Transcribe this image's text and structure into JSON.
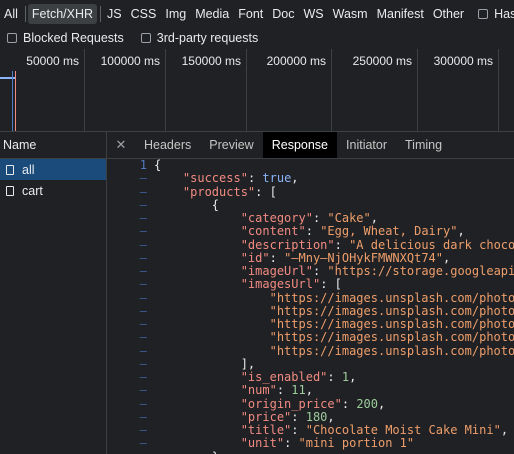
{
  "filters": {
    "types": [
      "All",
      "Fetch/XHR",
      "JS",
      "CSS",
      "Img",
      "Media",
      "Font",
      "Doc",
      "WS",
      "Wasm",
      "Manifest",
      "Other"
    ],
    "active": "Fetch/XHR",
    "has_label": "Has",
    "blocked_requests_label": "Blocked Requests",
    "third_party_label": "3rd-party requests"
  },
  "timeline": {
    "ticks": [
      "50000 ms",
      "100000 ms",
      "150000 ms",
      "200000 ms",
      "250000 ms",
      "300000 ms"
    ]
  },
  "requests": {
    "header": "Name",
    "items": [
      {
        "name": "all",
        "selected": true
      },
      {
        "name": "cart",
        "selected": false
      }
    ]
  },
  "detail": {
    "tabs": [
      "Headers",
      "Preview",
      "Response",
      "Initiator",
      "Timing"
    ],
    "active_tab": "Response",
    "close_icon": "close-icon"
  },
  "response": {
    "line_number": "1",
    "lines": [
      [
        [
          "p",
          "{"
        ]
      ],
      [
        [
          "p",
          "    "
        ],
        [
          "k",
          "\"success\""
        ],
        [
          "p",
          ": "
        ],
        [
          "b",
          "true"
        ],
        [
          "p",
          ","
        ]
      ],
      [
        [
          "p",
          "    "
        ],
        [
          "k",
          "\"products\""
        ],
        [
          "p",
          ": ["
        ]
      ],
      [
        [
          "p",
          "        {"
        ]
      ],
      [
        [
          "p",
          "            "
        ],
        [
          "k",
          "\"category\""
        ],
        [
          "p",
          ": "
        ],
        [
          "s",
          "\"Cake\""
        ],
        [
          "p",
          ","
        ]
      ],
      [
        [
          "p",
          "            "
        ],
        [
          "k",
          "\"content\""
        ],
        [
          "p",
          ": "
        ],
        [
          "s",
          "\"Egg, Wheat, Dairy\""
        ],
        [
          "p",
          ","
        ]
      ],
      [
        [
          "p",
          "            "
        ],
        [
          "k",
          "\"description\""
        ],
        [
          "p",
          ": "
        ],
        [
          "s",
          "\"A delicious dark choco"
        ]
      ],
      [
        [
          "p",
          "            "
        ],
        [
          "k",
          "\"id\""
        ],
        [
          "p",
          ": "
        ],
        [
          "s",
          "\"—Mny—NjOHykFMWNXQt74\""
        ],
        [
          "p",
          ","
        ]
      ],
      [
        [
          "p",
          "            "
        ],
        [
          "k",
          "\"imageUrl\""
        ],
        [
          "p",
          ": "
        ],
        [
          "s",
          "\"https://storage.googleapi"
        ]
      ],
      [
        [
          "p",
          "            "
        ],
        [
          "k",
          "\"imagesUrl\""
        ],
        [
          "p",
          ": ["
        ]
      ],
      [
        [
          "p",
          "                "
        ],
        [
          "s",
          "\"https://images.unsplash.com/photo"
        ]
      ],
      [
        [
          "p",
          "                "
        ],
        [
          "s",
          "\"https://images.unsplash.com/photo"
        ]
      ],
      [
        [
          "p",
          "                "
        ],
        [
          "s",
          "\"https://images.unsplash.com/photo"
        ]
      ],
      [
        [
          "p",
          "                "
        ],
        [
          "s",
          "\"https://images.unsplash.com/photo"
        ]
      ],
      [
        [
          "p",
          "                "
        ],
        [
          "s",
          "\"https://images.unsplash.com/photo"
        ]
      ],
      [
        [
          "p",
          "            ],"
        ]
      ],
      [
        [
          "p",
          "            "
        ],
        [
          "k",
          "\"is_enabled\""
        ],
        [
          "p",
          ": "
        ],
        [
          "n",
          "1"
        ],
        [
          "p",
          ","
        ]
      ],
      [
        [
          "p",
          "            "
        ],
        [
          "k",
          "\"num\""
        ],
        [
          "p",
          ": "
        ],
        [
          "n",
          "11"
        ],
        [
          "p",
          ","
        ]
      ],
      [
        [
          "p",
          "            "
        ],
        [
          "k",
          "\"origin_price\""
        ],
        [
          "p",
          ": "
        ],
        [
          "n",
          "200"
        ],
        [
          "p",
          ","
        ]
      ],
      [
        [
          "p",
          "            "
        ],
        [
          "k",
          "\"price\""
        ],
        [
          "p",
          ": "
        ],
        [
          "n",
          "180"
        ],
        [
          "p",
          ","
        ]
      ],
      [
        [
          "p",
          "            "
        ],
        [
          "k",
          "\"title\""
        ],
        [
          "p",
          ": "
        ],
        [
          "s",
          "\"Chocolate Moist Cake Mini\""
        ],
        [
          "p",
          ","
        ]
      ],
      [
        [
          "p",
          "            "
        ],
        [
          "k",
          "\"unit\""
        ],
        [
          "p",
          ": "
        ],
        [
          "s",
          "\"mini portion 1\""
        ]
      ],
      [
        [
          "p",
          "        },"
        ]
      ]
    ]
  }
}
